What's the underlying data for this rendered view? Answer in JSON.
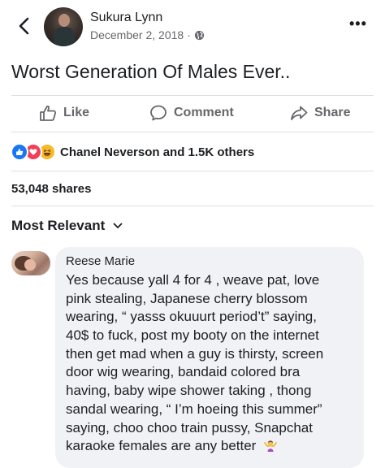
{
  "header": {
    "author": "Sukura Lynn",
    "date": "December 2, 2018",
    "separator": "·",
    "back_icon": "chevron-left-icon",
    "privacy_icon": "globe-icon",
    "more_label": "•••"
  },
  "post": {
    "text": "Worst Generation Of Males Ever.."
  },
  "actions": {
    "like": "Like",
    "comment": "Comment",
    "share": "Share"
  },
  "reactions": {
    "icons": [
      "like-icon",
      "love-icon",
      "haha-icon"
    ],
    "summary": "Chanel Neverson and 1.5K others",
    "colors": {
      "like": "#1877f2",
      "love": "#f33e58",
      "haha": "#f7b928"
    }
  },
  "shares": "53,048 shares",
  "sort": {
    "label": "Most Relevant"
  },
  "comment": {
    "author": "Reese Marie",
    "lines": [
      "Yes because yall 4 for 4 , weave pat, love",
      "pink stealing, Japanese cherry blossom",
      "wearing, “ yasss okuuurt period’t” saying,",
      "40$ to fuck, post my booty on the internet",
      "then get mad when a guy is thirsty, screen",
      "door wig wearing, bandaid colored bra",
      "having, baby wipe shower taking , thong",
      "sandal wearing, “ I’m hoeing this summer”",
      "saying, choo choo train pussy, Snapchat",
      "karaoke females are any better"
    ],
    "trailing_emoji": "person-shrugging-emoji"
  }
}
